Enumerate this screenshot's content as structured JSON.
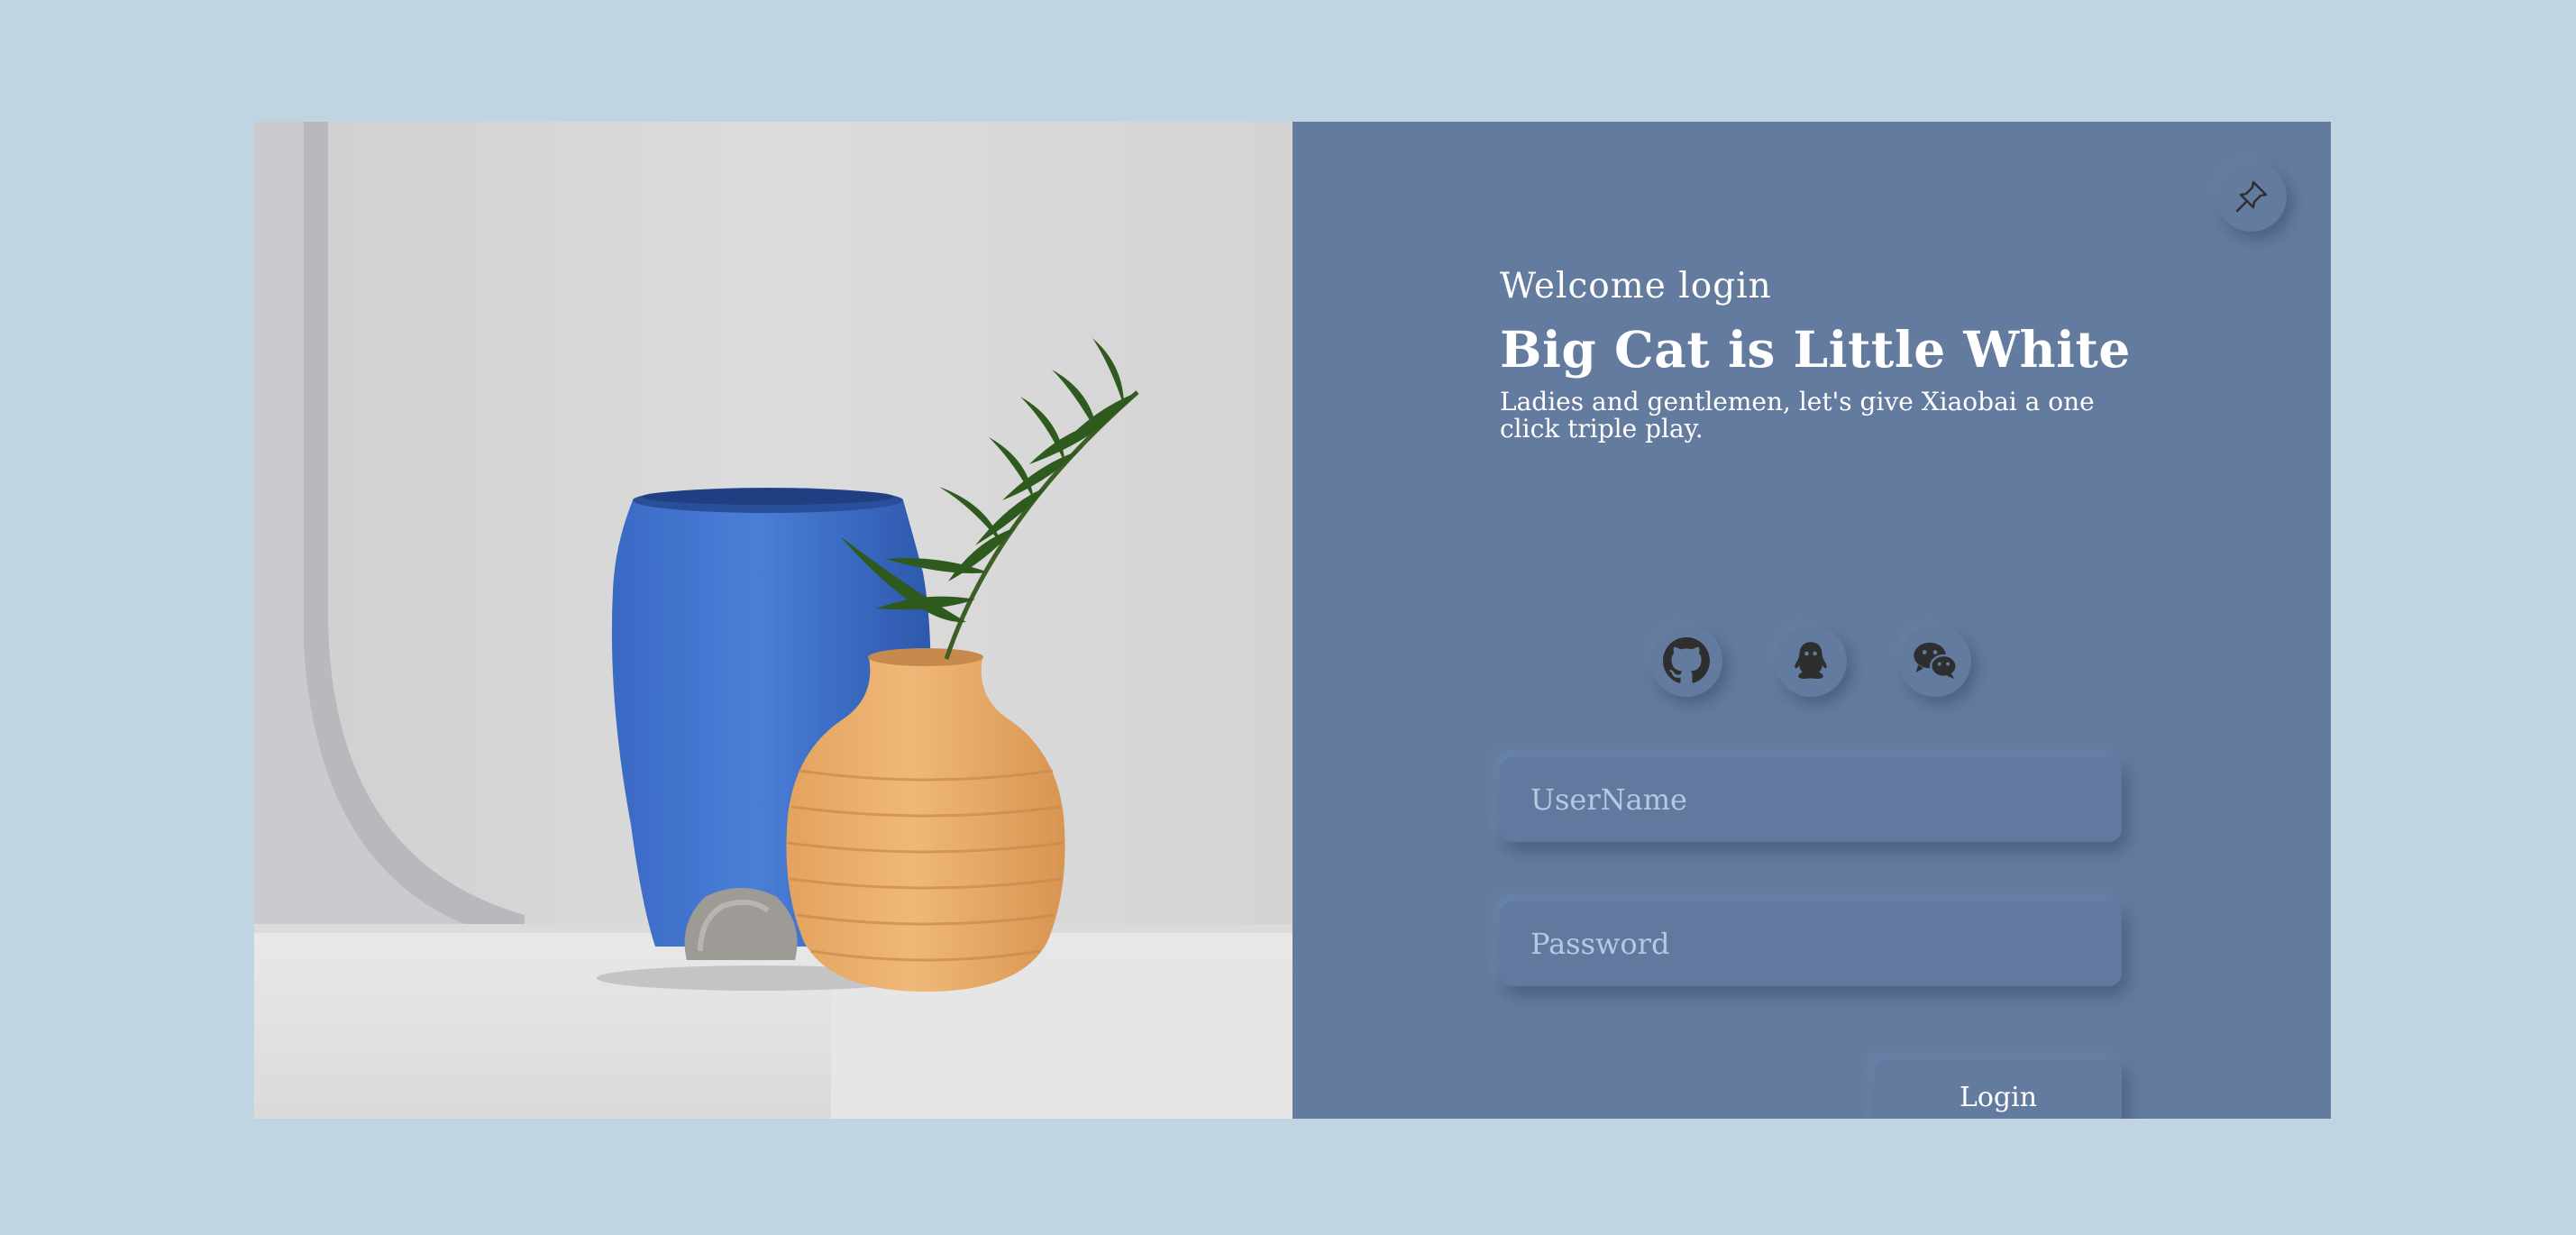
{
  "header": {
    "welcome": "Welcome login",
    "title": "Big Cat is Little White",
    "subtitle": "Ladies and gentlemen, let's give Xiaobai a one click triple play."
  },
  "social": [
    {
      "name": "github-icon"
    },
    {
      "name": "qq-icon"
    },
    {
      "name": "wechat-icon"
    }
  ],
  "form": {
    "username_placeholder": "UserName",
    "username_value": "",
    "password_placeholder": "Password",
    "password_value": "",
    "login_label": "Login"
  },
  "toolbar": {
    "pin_icon": "pin-icon"
  },
  "colors": {
    "page_background": "#c0d4e1",
    "panel_background": "#637b9e",
    "text": "#ffffff",
    "placeholder": "#b8c8e2",
    "vase_blue": "#3d6ec6",
    "vase_orange": "#e8ad6c",
    "leaf_green": "#2f5a1e"
  }
}
